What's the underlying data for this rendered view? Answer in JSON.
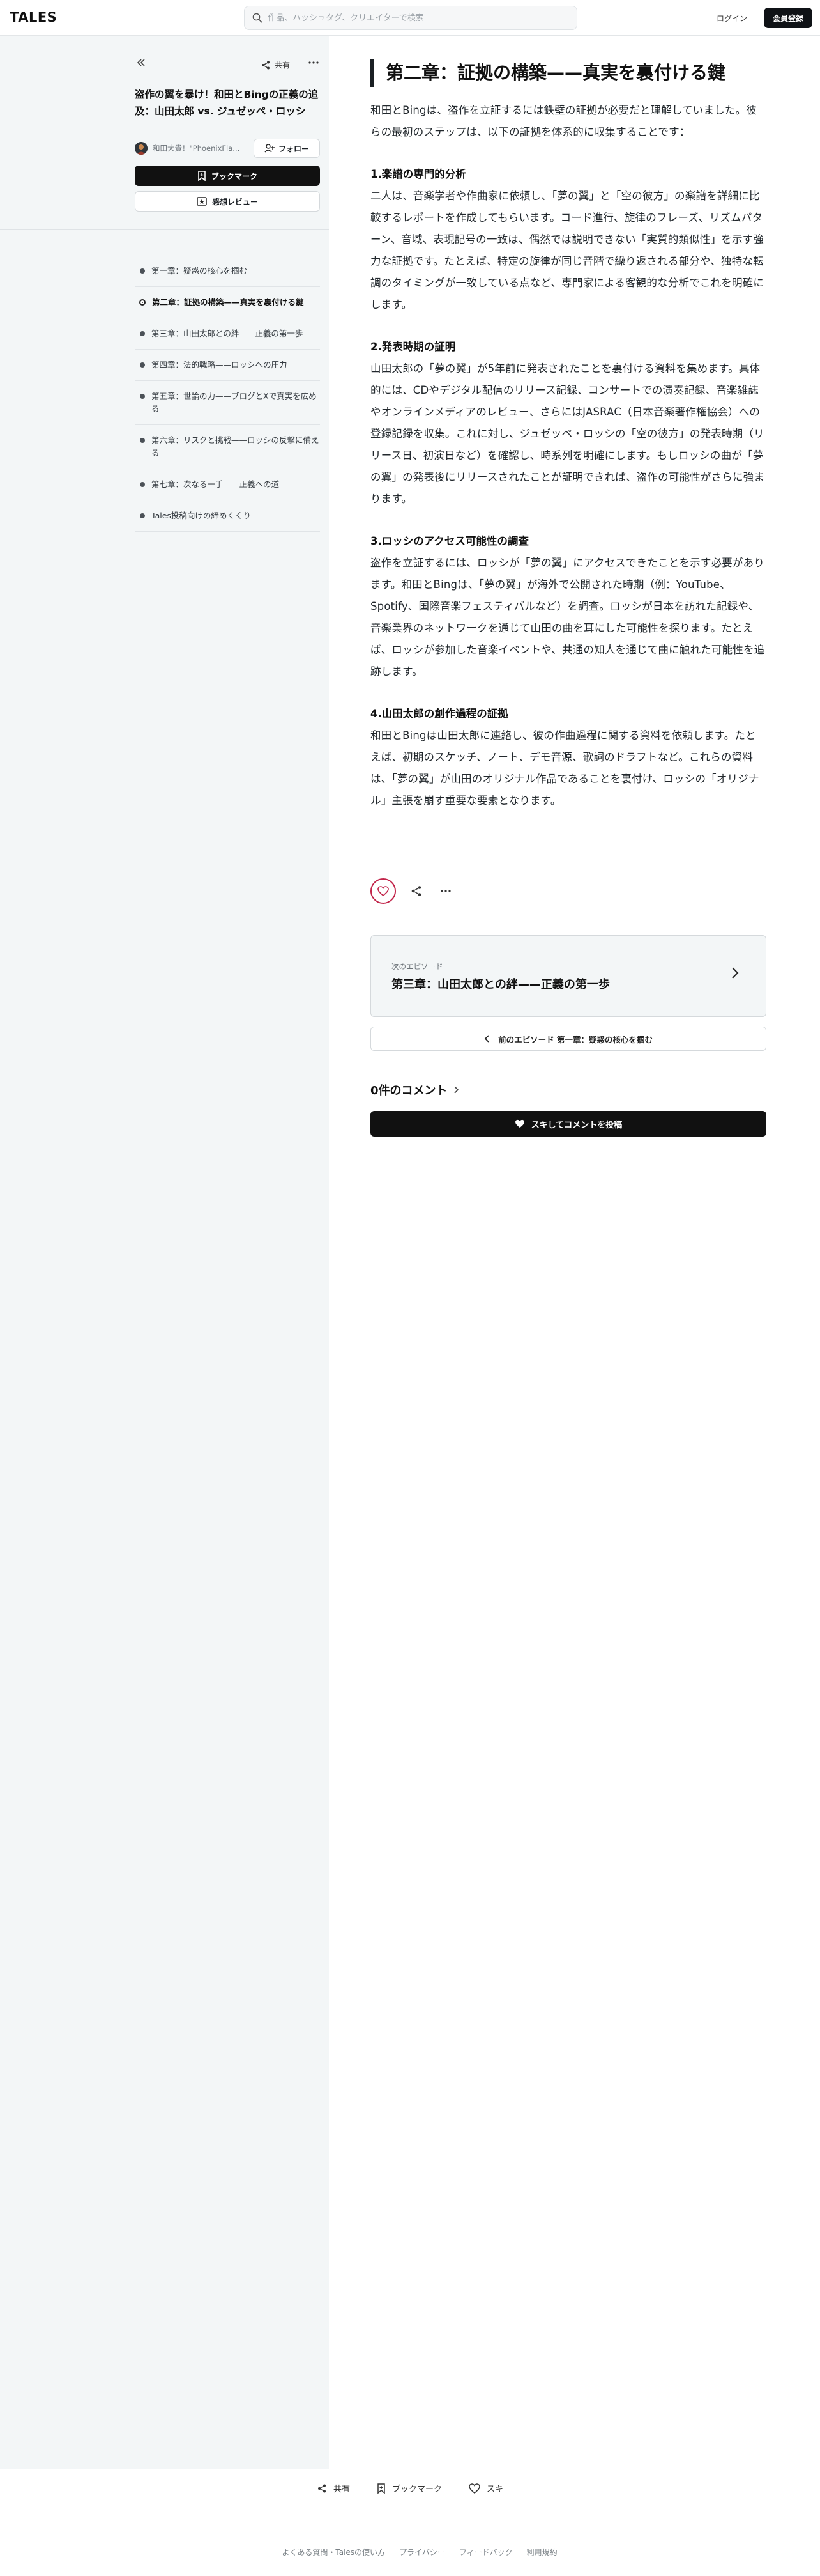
{
  "header": {
    "logo": "TALES",
    "search_placeholder": "作品、ハッシュタグ、クリエイターで検索",
    "login_label": "ログイン",
    "signup_label": "会員登録"
  },
  "sidebar": {
    "share_label": "共有",
    "work_title": "盗作の翼を暴け！和田とBingの正義の追及：山田太郎 vs. ジュゼッペ・ロッシ",
    "author_name": "和田大貴！\"PhoenixFla...",
    "follow_label": "フォロー",
    "bookmark_label": "ブックマーク",
    "review_label": "感想レビュー",
    "toc": [
      {
        "label": "第一章：疑惑の核心を掴む",
        "current": false
      },
      {
        "label": "第二章：証拠の構築——真実を裏付ける鍵",
        "current": true
      },
      {
        "label": "第三章：山田太郎との絆——正義の第一歩",
        "current": false
      },
      {
        "label": "第四章：法的戦略——ロッシへの圧力",
        "current": false
      },
      {
        "label": "第五章：世論の力——ブログとXで真実を広める",
        "current": false
      },
      {
        "label": "第六章：リスクと挑戦——ロッシの反撃に備える",
        "current": false
      },
      {
        "label": "第七章：次なる一手——正義への道",
        "current": false
      },
      {
        "label": "Tales投稿向けの締めくくり",
        "current": false
      }
    ]
  },
  "main": {
    "chapter_title": "第二章：証拠の構築——真実を裏付ける鍵",
    "intro": "和田とBingは、盗作を立証するには鉄壁の証拠が必要だと理解していました。彼らの最初のステップは、以下の証拠を体系的に収集することです：",
    "sections": [
      {
        "heading": "1.楽譜の専門的分析",
        "body": "二人は、音楽学者や作曲家に依頼し、「夢の翼」と「空の彼方」の楽譜を詳細に比較するレポートを作成してもらいます。コード進行、旋律のフレーズ、リズムパターン、音域、表現記号の一致は、偶然では説明できない「実質的類似性」を示す強力な証拠です。たとえば、特定の旋律が同じ音階で繰り返される部分や、独特な転調のタイミングが一致している点など、専門家による客観的な分析でこれを明確にします。"
      },
      {
        "heading": "2.発表時期の証明",
        "body": "山田太郎の「夢の翼」が5年前に発表されたことを裏付ける資料を集めます。具体的には、CDやデジタル配信のリリース記録、コンサートでの演奏記録、音楽雑誌やオンラインメディアのレビュー、さらにはJASRAC（日本音楽著作権協会）への登録記録を収集。これに対し、ジュゼッペ・ロッシの「空の彼方」の発表時期（リリース日、初演日など）を確認し、時系列を明確にします。もしロッシの曲が「夢の翼」の発表後にリリースされたことが証明できれば、盗作の可能性がさらに強まります。"
      },
      {
        "heading": "3.ロッシのアクセス可能性の調査",
        "body": "盗作を立証するには、ロッシが「夢の翼」にアクセスできたことを示す必要があります。和田とBingは、「夢の翼」が海外で公開された時期（例：YouTube、Spotify、国際音楽フェスティバルなど）を調査。ロッシが日本を訪れた記録や、音楽業界のネットワークを通じて山田の曲を耳にした可能性を探ります。たとえば、ロッシが参加した音楽イベントや、共通の知人を通じて曲に触れた可能性を追跡します。"
      },
      {
        "heading": "4.山田太郎の創作過程の証拠",
        "body": "和田とBingは山田太郎に連絡し、彼の作曲過程に関する資料を依頼します。たとえば、初期のスケッチ、ノート、デモ音源、歌詞のドラフトなど。これらの資料は、「夢の翼」が山田のオリジナル作品であることを裏付け、ロッシの「オリジナル」主張を崩す重要な要素となります。"
      }
    ],
    "next_label": "次のエピソード",
    "next_title": "第三章：山田太郎との絆——正義の第一歩",
    "prev_label": "前のエピソード 第一章：疑惑の核心を掴む",
    "comments_title": "0件のコメント",
    "comment_button": "スキしてコメントを投稿"
  },
  "bottom_bar": {
    "share": "共有",
    "bookmark": "ブックマーク",
    "like": "スキ"
  },
  "footer_links": [
    "よくある質問・Talesの使い方",
    "プライバシー",
    "フィードバック",
    "利用規約"
  ]
}
